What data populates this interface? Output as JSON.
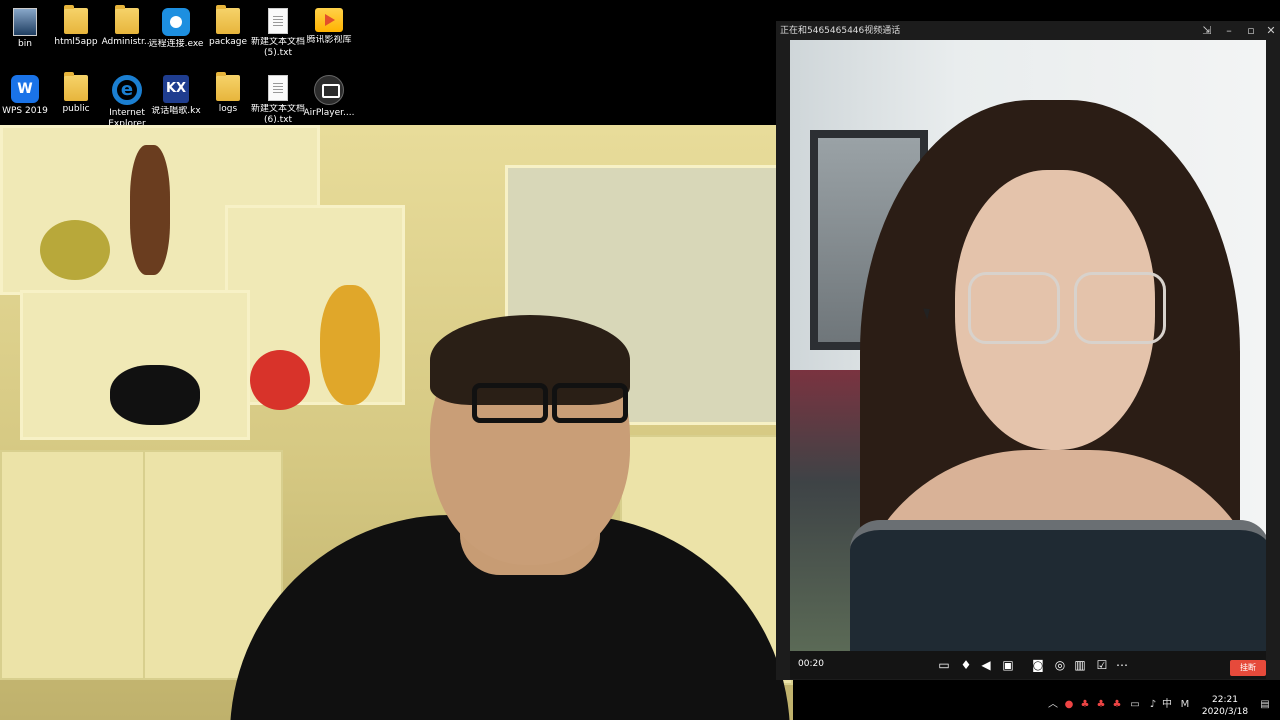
{
  "desktop": {
    "icons": [
      {
        "label": "bin",
        "icon": "image-file-icon"
      },
      {
        "label": "html5app",
        "icon": "folder-icon"
      },
      {
        "label": "Administr...",
        "icon": "user-folder-icon"
      },
      {
        "label": "远程连接.exe",
        "icon": "teamviewer-icon"
      },
      {
        "label": "package",
        "icon": "folder-icon"
      },
      {
        "label": "新建文本文档 (5).txt",
        "icon": "text-file-icon"
      },
      {
        "label": "腾讯影视库",
        "icon": "video-folder-icon"
      },
      {
        "label": "WPS 2019",
        "icon": "wps-icon"
      },
      {
        "label": "public",
        "icon": "folder-icon"
      },
      {
        "label": "Internet Explorer",
        "icon": "ie-icon"
      },
      {
        "label": "说话唱歌.kx",
        "icon": "kx-icon"
      },
      {
        "label": "logs",
        "icon": "folder-icon"
      },
      {
        "label": "新建文本文档 (6).txt",
        "icon": "text-file-icon"
      },
      {
        "label": "AirPlayer....",
        "icon": "airplayer-icon"
      }
    ]
  },
  "call_window": {
    "title": "正在和5465465446视频通话",
    "timer": "00:20",
    "hangup_label": "挂断",
    "controls": [
      "chat-icon",
      "microphone-icon",
      "speaker-icon",
      "camera-toggle-icon",
      "screenshot-icon",
      "record-icon",
      "layout-icon",
      "edit-icon",
      "more-icon"
    ],
    "title_buttons": [
      "pin-icon",
      "minimize-icon",
      "maximize-icon",
      "close-icon"
    ]
  },
  "taskbar": {
    "tray_icons": [
      "chevron-up-icon",
      "app-icon",
      "app-icon",
      "app-icon",
      "app-icon",
      "network-icon",
      "volume-icon",
      "ime-icon",
      "ime-mode-icon",
      "notification-icon"
    ],
    "ime_label": "中",
    "ime_mode": "M",
    "clock_time": "22:21",
    "clock_date": "2020/3/18"
  }
}
